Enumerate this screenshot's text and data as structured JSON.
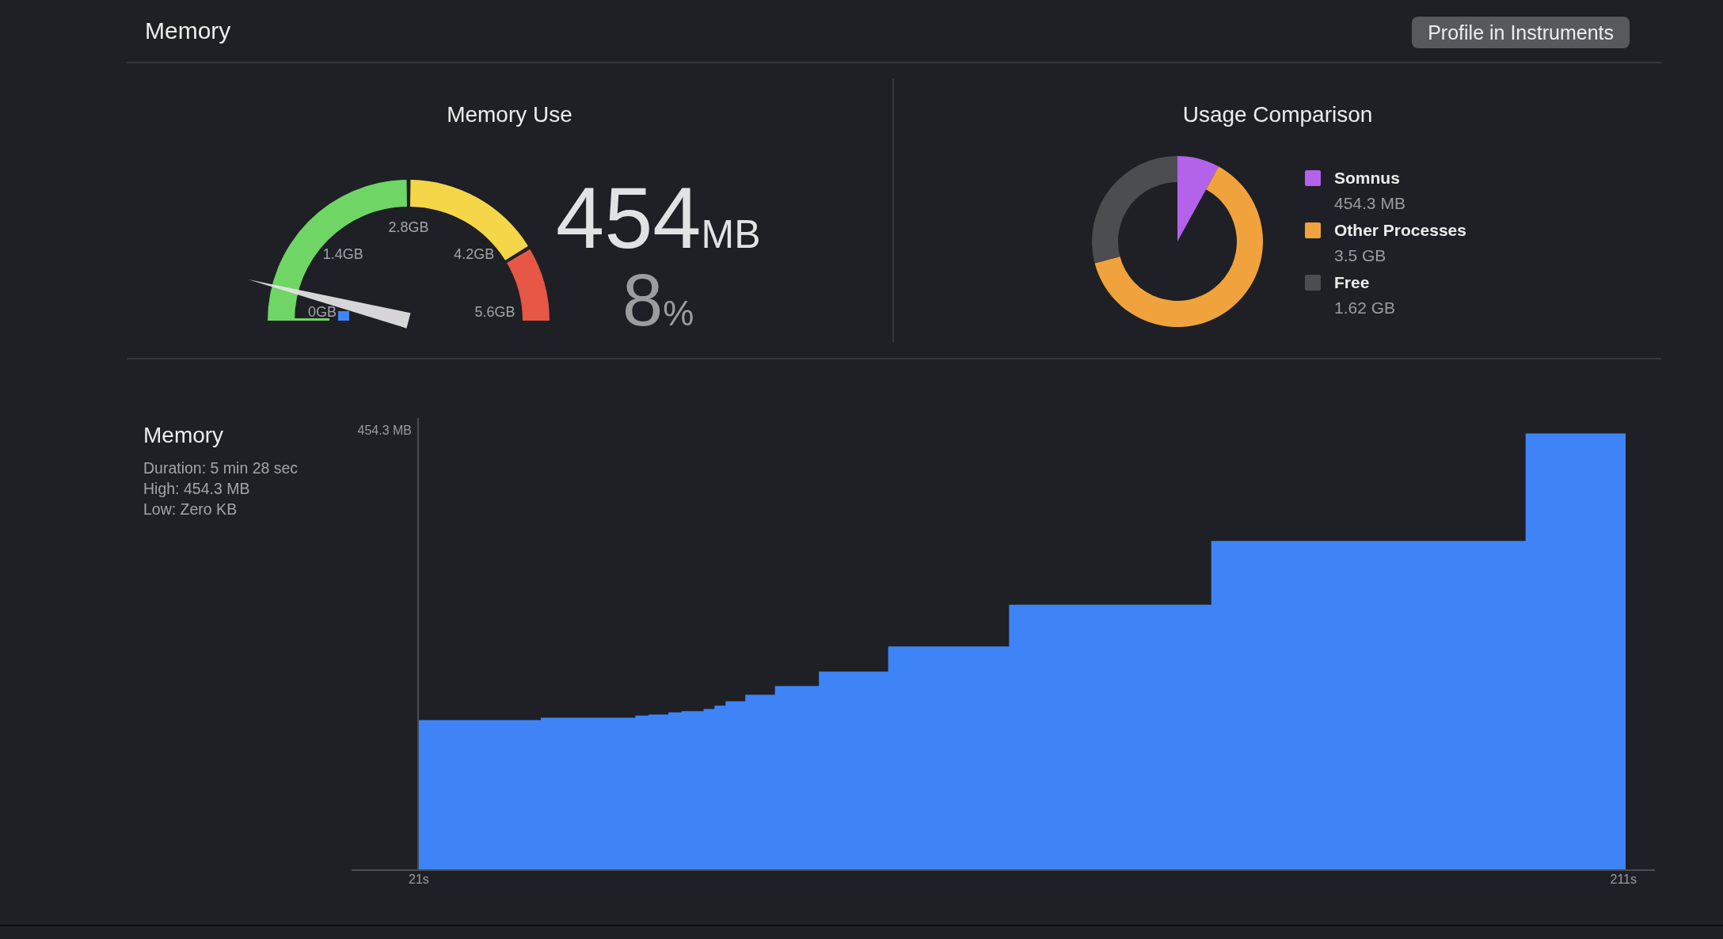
{
  "header": {
    "title": "Memory",
    "button": "Profile in Instruments"
  },
  "memory_use": {
    "title": "Memory Use",
    "gauge": {
      "level": 0.08,
      "scale_labels": [
        "0GB",
        "1.4GB",
        "2.8GB",
        "4.2GB",
        "5.6GB"
      ]
    },
    "value": "454",
    "unit": "MB",
    "percent": "8",
    "percent_sign": "%"
  },
  "usage_comparison": {
    "title": "Usage Comparison",
    "chart_data": {
      "type": "pie",
      "series": [
        {
          "values": [
            8.0,
            62.9,
            29.1
          ]
        }
      ]
    },
    "legend": [
      {
        "name": "Somnus",
        "value": "454.3 MB",
        "color": "#b263ea"
      },
      {
        "name": "Other Processes",
        "value": "3.5 GB",
        "color": "#f0a33c"
      },
      {
        "name": "Free",
        "value": "1.62 GB",
        "color": "#4c4d51"
      }
    ]
  },
  "memory_chart": {
    "title": "Memory",
    "details": [
      "Duration: 5 min 28 sec",
      "High: 454.3 MB",
      "Low: Zero KB"
    ],
    "y_label": "454.3 MB",
    "x_labels": [
      "21s",
      "211s"
    ]
  }
}
